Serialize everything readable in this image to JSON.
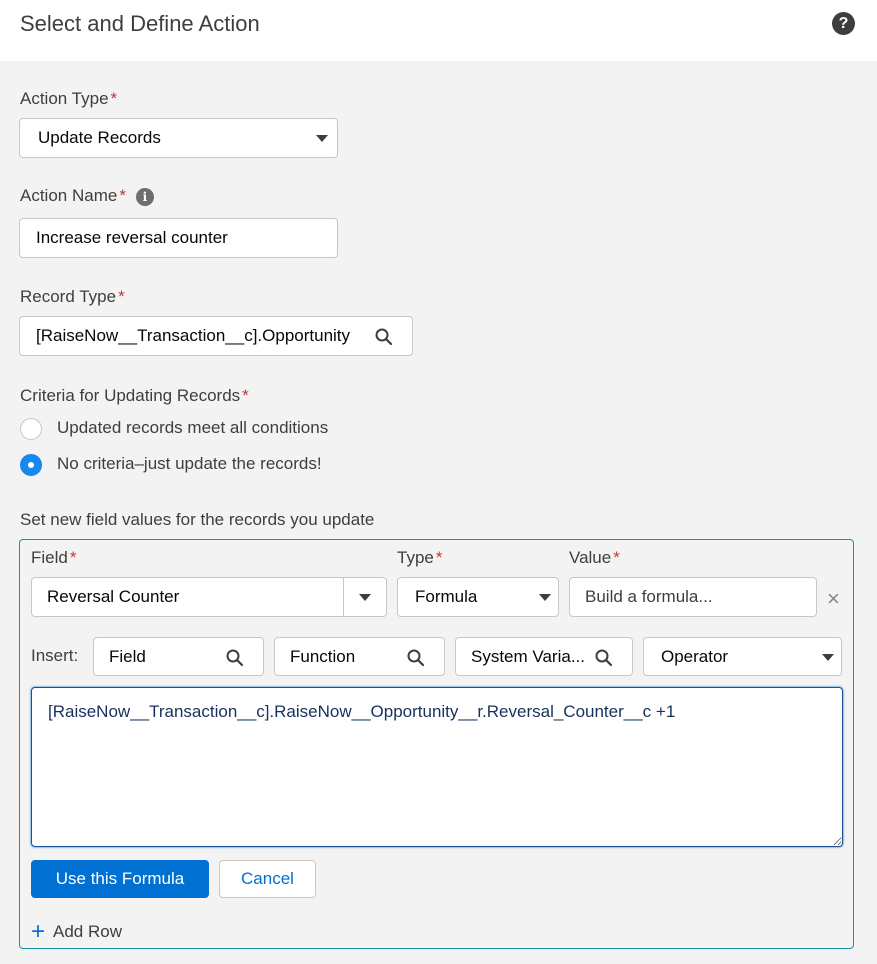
{
  "header": {
    "title": "Select and Define Action",
    "help_icon": "?"
  },
  "action_type": {
    "label": "Action Type",
    "required": "*",
    "value": "Update Records"
  },
  "action_name": {
    "label": "Action Name",
    "required": "*",
    "info_icon": "i",
    "value": "Increase reversal counter"
  },
  "record_type": {
    "label": "Record Type",
    "required": "*",
    "value": "[RaiseNow__Transaction__c].Opportunity"
  },
  "criteria": {
    "label": "Criteria for Updating Records",
    "required": "*",
    "options": [
      {
        "label": "Updated records meet all conditions",
        "checked": false
      },
      {
        "label": "No criteria–just update the records!",
        "checked": true
      }
    ]
  },
  "field_values": {
    "section_label": "Set new field values for the records you update",
    "field_header": "Field",
    "type_header": "Type",
    "value_header": "Value",
    "required": "*",
    "field_value": "Reversal Counter",
    "type_value": "Formula",
    "value_placeholder": "Build a formula...",
    "remove_icon": "×",
    "insert_label": "Insert:",
    "insert_field": "Field",
    "insert_function": "Function",
    "insert_system_variable": "System Varia...",
    "insert_operator": "Operator",
    "formula_text": "[RaiseNow__Transaction__c].RaiseNow__Opportunity__r.Reversal_Counter__c +1",
    "use_formula_button": "Use this Formula",
    "cancel_button": "Cancel",
    "add_row_icon": "+",
    "add_row_label": "Add Row"
  },
  "colors": {
    "accent": "#0070d2",
    "required": "#c23934",
    "panel_border": "#1b96a8",
    "radio_selected": "#1589ee"
  }
}
